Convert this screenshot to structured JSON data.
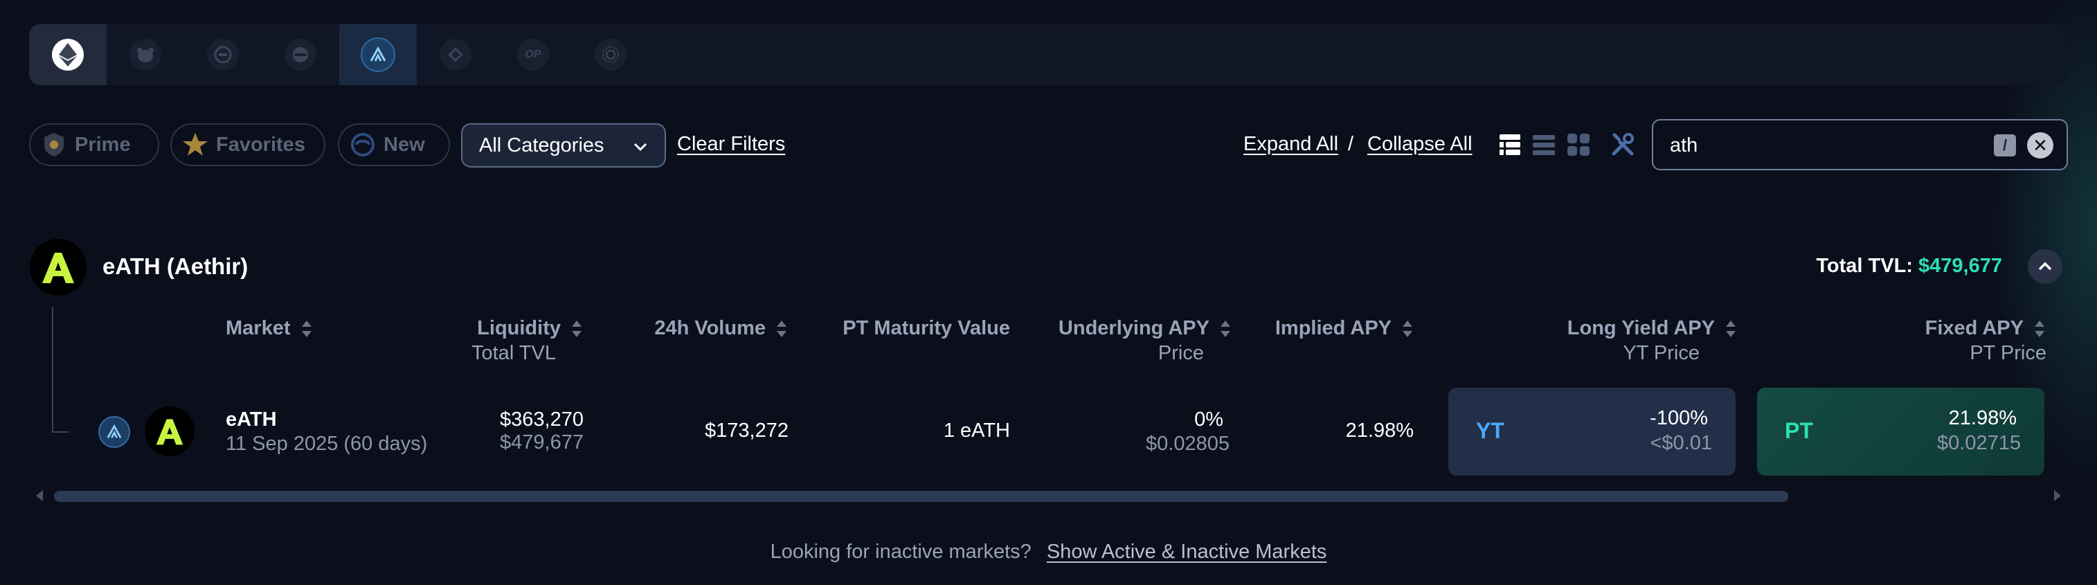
{
  "chains": [
    {
      "name": "ethereum-icon",
      "glyph": "◆"
    },
    {
      "name": "bnb-bear-icon",
      "glyph": "●"
    },
    {
      "name": "bnb-chain-icon",
      "glyph": "◈"
    },
    {
      "name": "mantle-icon",
      "glyph": "⊖"
    },
    {
      "name": "arbitrum-icon",
      "glyph": "▲"
    },
    {
      "name": "binance-icon",
      "glyph": "◇"
    },
    {
      "name": "optimism-icon",
      "glyph": "OP"
    },
    {
      "name": "sonic-icon",
      "glyph": "✺"
    }
  ],
  "filters": {
    "prime": "Prime",
    "favorites": "Favorites",
    "new": "New",
    "category": "All Categories",
    "clear": "Clear Filters"
  },
  "controls": {
    "expand_all": "Expand All",
    "separator": "/",
    "collapse_all": "Collapse All",
    "search_value": "ath",
    "search_shortcut": "/",
    "clear_search": "✕"
  },
  "group": {
    "title": "eATH (Aethir)",
    "tvl_label": "Total TVL:",
    "tvl_value": "$479,677"
  },
  "columns": {
    "market": "Market",
    "liquidity": "Liquidity",
    "liquidity_sub": "Total TVL",
    "volume": "24h Volume",
    "pt_maturity": "PT Maturity Value",
    "underlying_apy": "Underlying APY",
    "underlying_sub": "Price",
    "implied_apy": "Implied APY",
    "long_yield": "Long Yield APY",
    "long_yield_sub": "YT Price",
    "fixed_apy": "Fixed APY",
    "fixed_sub": "PT Price"
  },
  "row": {
    "name": "eATH",
    "maturity": "11 Sep 2025 (60 days)",
    "liquidity": "$363,270",
    "tvl": "$479,677",
    "volume": "$173,272",
    "pt_value": "1 eATH",
    "underlying_apy": "0%",
    "price": "$0.02805",
    "implied_apy": "21.98%",
    "yt_tag": "YT",
    "yt_apy": "-100%",
    "yt_price": "<$0.01",
    "pt_tag": "PT",
    "pt_apy": "21.98%",
    "pt_price": "$0.02715"
  },
  "footer": {
    "text": "Looking for inactive markets?",
    "link": "Show Active & Inactive Markets"
  },
  "colors": {
    "accent_green": "#2ee0b0",
    "aethir_yellow": "#c8f542",
    "yt_blue": "#4aa8ff"
  }
}
